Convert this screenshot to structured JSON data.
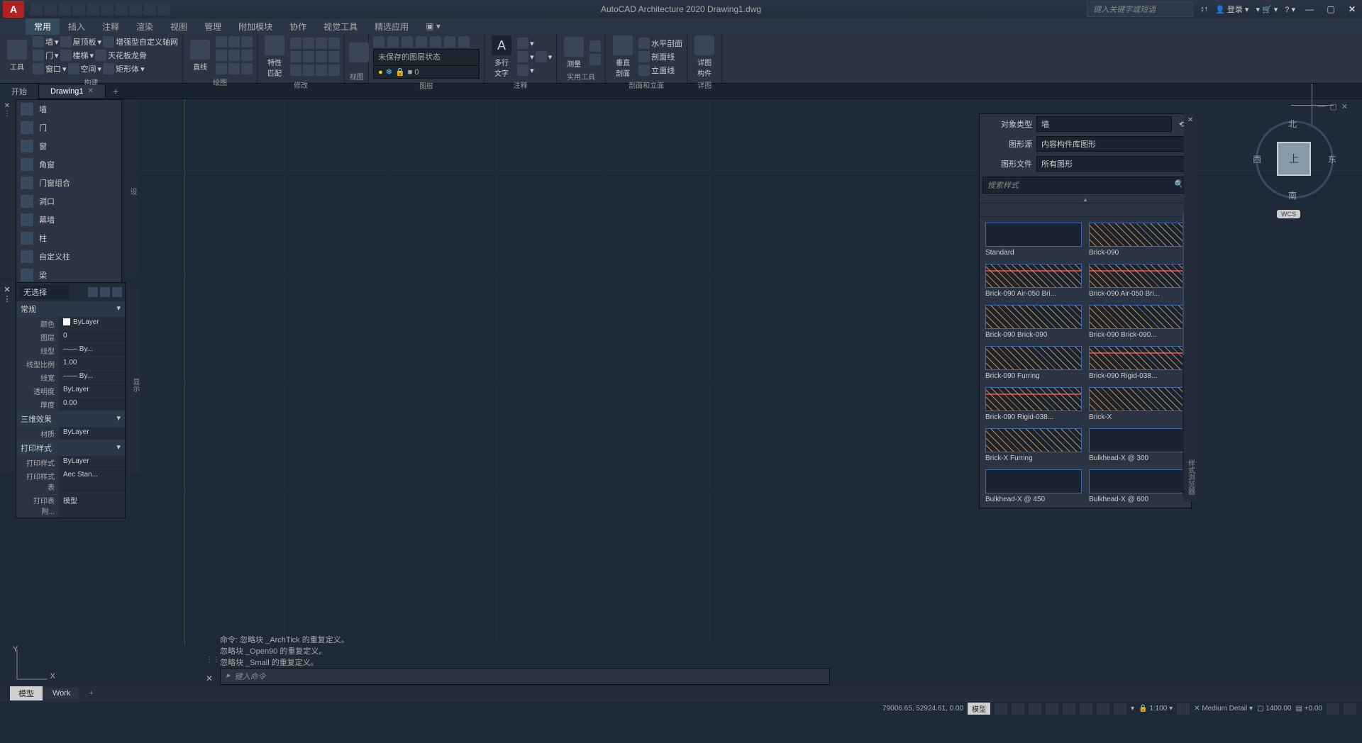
{
  "titlebar": {
    "app_badge": "A",
    "center_title": "AutoCAD Architecture 2020    Drawing1.dwg",
    "search_placeholder": "键入关键字或短语",
    "login": "登录"
  },
  "menutabs": [
    "常用",
    "插入",
    "注释",
    "渲染",
    "视图",
    "管理",
    "附加模块",
    "协作",
    "视觉工具",
    "精选应用"
  ],
  "ribbon": {
    "panel1": {
      "main": "工具",
      "r1": [
        "墙",
        "屋顶板",
        "增强型自定义轴网"
      ],
      "r2": [
        "门",
        "楼梯",
        "天花板龙骨"
      ],
      "r3": [
        "窗口",
        "空间",
        "矩形体"
      ],
      "label": "构建"
    },
    "panel2": {
      "main": "直线",
      "label": "绘图"
    },
    "panel3": {
      "main": "特性\n匹配",
      "label": "修改"
    },
    "panel4": {
      "layer_state": "未保存的图层状态",
      "main": "",
      "label": "图层"
    },
    "panel5": {
      "main": "多行\n文字",
      "label": "注释"
    },
    "panel6": {
      "main": "测量",
      "label": "实用工具"
    },
    "panel7": {
      "main": "垂直\n剖面",
      "r1": "水平剖面",
      "r2": "剖面线",
      "r3": "立面线",
      "label": "剖面和立面"
    },
    "panel8": {
      "main": "详图\n构件",
      "label": "详图"
    }
  },
  "filetabs": {
    "start": "开始",
    "drawing": "Drawing1"
  },
  "toolpalette": {
    "items": [
      "墙",
      "门",
      "窗",
      "角窗",
      "门窗组合",
      "洞口",
      "幕墙",
      "柱",
      "自定义柱",
      "梁"
    ]
  },
  "props": {
    "selection": "无选择",
    "group1": "常规",
    "rows1": [
      {
        "label": "颜色",
        "value": "ByLayer",
        "swatch": true
      },
      {
        "label": "图层",
        "value": "0"
      },
      {
        "label": "线型",
        "value": "—— By..."
      },
      {
        "label": "线型比例",
        "value": "1.00"
      },
      {
        "label": "线宽",
        "value": "—— By..."
      },
      {
        "label": "透明度",
        "value": "ByLayer"
      },
      {
        "label": "厚度",
        "value": "0.00"
      }
    ],
    "group2": "三维效果",
    "rows2": [
      {
        "label": "材质",
        "value": "ByLayer"
      }
    ],
    "group3": "打印样式",
    "rows3": [
      {
        "label": "打印样式",
        "value": "ByLayer"
      },
      {
        "label": "打印样式表",
        "value": "Aec Stan..."
      },
      {
        "label": "打印表附...",
        "value": "模型"
      }
    ]
  },
  "styles": {
    "row1_label": "对象类型",
    "row1_value": "墙",
    "row2_label": "图形源",
    "row2_value": "内容构件库图形",
    "row3_label": "图形文件",
    "row3_value": "所有图形",
    "search_placeholder": "搜索样式",
    "items": [
      "Standard",
      "Brick-090",
      "Brick-090 Air-050 Bri...",
      "Brick-090 Air-050 Bri...",
      "Brick-090 Brick-090",
      "Brick-090 Brick-090...",
      "Brick-090 Furring",
      "Brick-090 Rigid-038...",
      "Brick-090 Rigid-038...",
      "Brick-X",
      "Brick-X Furring",
      "Bulkhead-X @ 300",
      "Bulkhead-X @ 450",
      "Bulkhead-X @ 600"
    ]
  },
  "viewcube": {
    "top": "上",
    "n": "北",
    "s": "南",
    "e": "东",
    "w": "西",
    "wcs": "WCS"
  },
  "cmd": {
    "hist1": "命令: 忽略块 _ArchTick 的重复定义。",
    "hist2": "忽略块 _Open90 的重复定义。",
    "hist3": "忽略块 _Small 的重复定义。",
    "prompt_icon": "▸",
    "placeholder": "键入命令"
  },
  "layouts": {
    "model": "模型",
    "work": "Work"
  },
  "status": {
    "coords": "79006.65, 52924.61, 0.00",
    "mode": "模型",
    "scale_label": "1:100",
    "detail": "Medium Detail",
    "elev": "1400.00",
    "cut": "+0.00"
  }
}
